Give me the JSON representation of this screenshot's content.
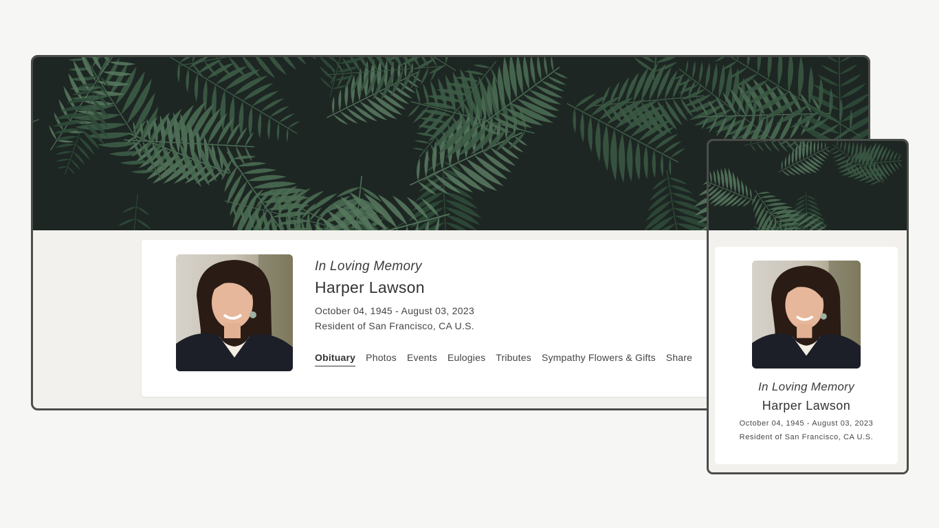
{
  "profile": {
    "memory_label": "In Loving Memory",
    "name": "Harper Lawson",
    "dates": "October 04, 1945 - August 03, 2023",
    "residence": "Resident of San Francisco, CA U.S."
  },
  "tabs": [
    {
      "label": "Obituary",
      "active": true
    },
    {
      "label": "Photos",
      "active": false
    },
    {
      "label": "Events",
      "active": false
    },
    {
      "label": "Eulogies",
      "active": false
    },
    {
      "label": "Tributes",
      "active": false
    },
    {
      "label": "Sympathy Flowers & Gifts",
      "active": false
    },
    {
      "label": "Share",
      "active": false
    }
  ],
  "colors": {
    "page_background": "#f6f6f5",
    "frame_border": "#4a4d48",
    "content_background": "#f2f1ed",
    "banner_dark": "#1d2623",
    "leaf_green": "#3f5e48"
  }
}
